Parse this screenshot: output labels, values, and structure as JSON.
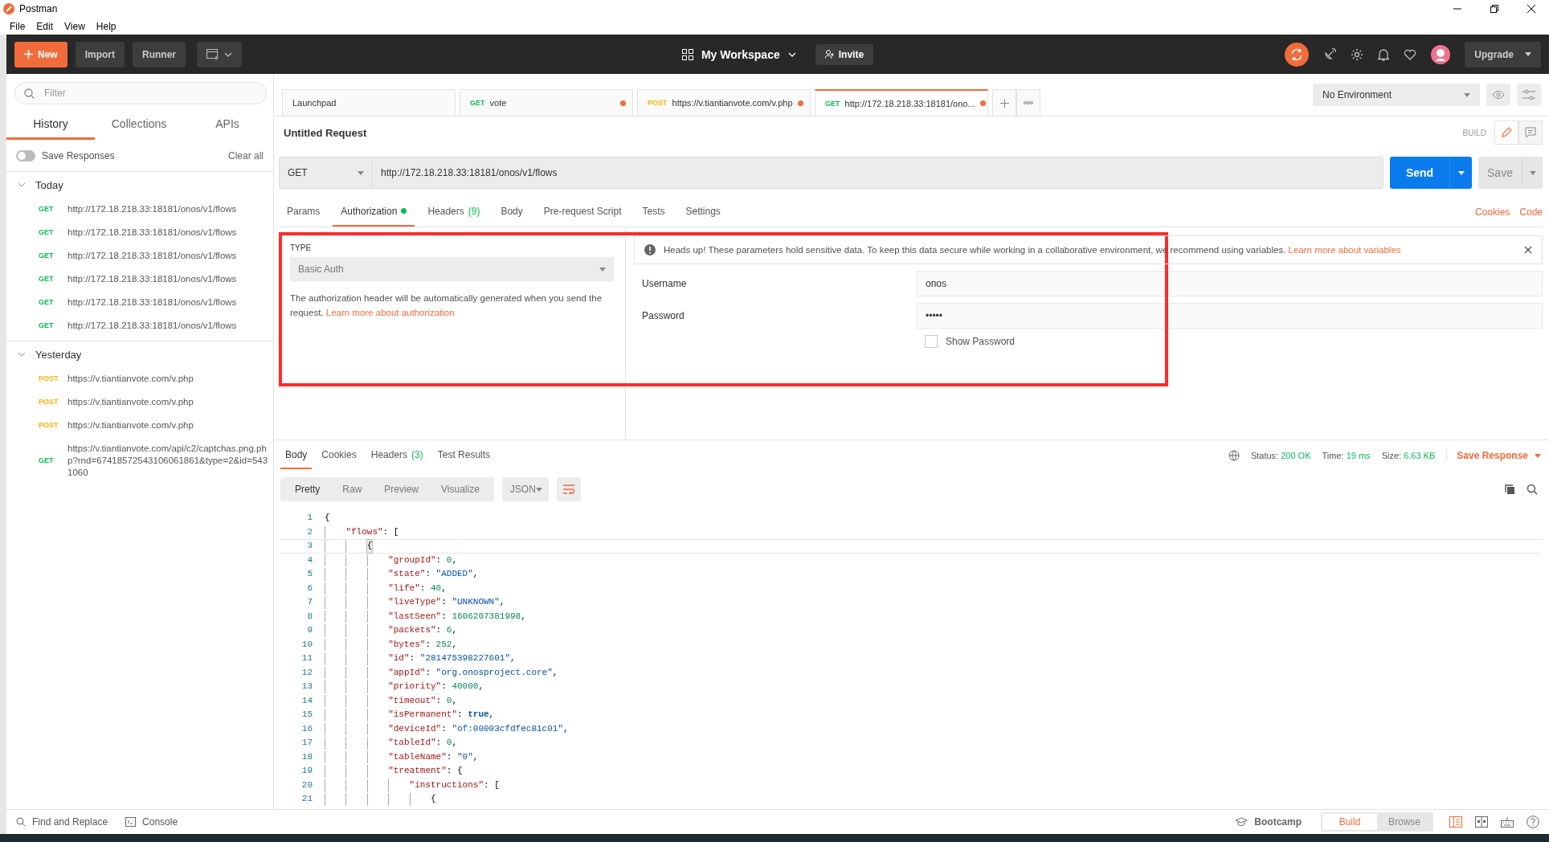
{
  "window": {
    "title": "Postman",
    "menu": [
      "File",
      "Edit",
      "View",
      "Help"
    ]
  },
  "header": {
    "new_button": "New",
    "buttons": [
      "Import",
      "Runner"
    ],
    "workspace": "My Workspace",
    "invite": "Invite",
    "upgrade": "Upgrade"
  },
  "sidebar": {
    "filter_placeholder": "Filter",
    "tabs": [
      {
        "label": "History",
        "selected": true
      },
      {
        "label": "Collections",
        "selected": false
      },
      {
        "label": "APIs",
        "selected": false
      }
    ],
    "save_responses": {
      "label": "Save Responses",
      "on": false
    },
    "clear_all": "Clear all",
    "groups": [
      {
        "label": "Today",
        "expanded": true,
        "items": [
          {
            "method": "GET",
            "color": "#0cbb52",
            "url": "http://172.18.218.33:18181/onos/v1/flows"
          },
          {
            "method": "GET",
            "color": "#0cbb52",
            "url": "http://172.18.218.33:18181/onos/v1/flows"
          },
          {
            "method": "GET",
            "color": "#0cbb52",
            "url": "http://172.18.218.33:18181/onos/v1/flows"
          },
          {
            "method": "GET",
            "color": "#0cbb52",
            "url": "http://172.18.218.33:18181/onos/v1/flows"
          },
          {
            "method": "GET",
            "color": "#0cbb52",
            "url": "http://172.18.218.33:18181/onos/v1/flows"
          },
          {
            "method": "GET",
            "color": "#0cbb52",
            "url": "http://172.18.218.33:18181/onos/v1/flows"
          }
        ]
      },
      {
        "label": "Yesterday",
        "expanded": true,
        "items": [
          {
            "method": "POST",
            "color": "#ffb400",
            "url": "https://v.tiantianvote.com/v.php"
          },
          {
            "method": "POST",
            "color": "#ffb400",
            "url": "https://v.tiantianvote.com/v.php"
          },
          {
            "method": "POST",
            "color": "#ffb400",
            "url": "https://v.tiantianvote.com/v.php"
          },
          {
            "method": "GET",
            "color": "#0cbb52",
            "url": "https://v.tiantianvote.com/api/c2/captchas.png.php?rnd=67418572543106061861&type=2&id=5431060"
          }
        ]
      }
    ]
  },
  "tabs": {
    "items": [
      {
        "label": "Launchpad",
        "selected": false,
        "unsaved": false
      },
      {
        "method": "GET",
        "color": "#0cbb52",
        "label": "vote",
        "selected": false,
        "unsaved": true
      },
      {
        "method": "POST",
        "color": "#ffb400",
        "label": "https://v.tiantianvote.com/v.php",
        "selected": false,
        "unsaved": true
      },
      {
        "method": "GET",
        "color": "#0cbb52",
        "label": "http://172.18.218.33:18181/ono...",
        "selected": true,
        "unsaved": true
      }
    ],
    "environment": "No Environment"
  },
  "request": {
    "title": "Untitled Request",
    "mode_label": "BUILD",
    "method": "GET",
    "url": "http://172.18.218.33:18181/onos/v1/flows",
    "send": "Send",
    "save": "Save",
    "tabs": [
      {
        "label": "Params",
        "selected": false,
        "indicator": false
      },
      {
        "label": "Authorization",
        "selected": true,
        "indicator": true
      },
      {
        "label": "Headers",
        "count": "(9)",
        "selected": false,
        "indicator": false
      },
      {
        "label": "Body",
        "selected": false,
        "indicator": false
      },
      {
        "label": "Pre-request Script",
        "selected": false,
        "indicator": false
      },
      {
        "label": "Tests",
        "selected": false,
        "indicator": false
      },
      {
        "label": "Settings",
        "selected": false,
        "indicator": false
      }
    ],
    "links": [
      "Cookies",
      "Code"
    ],
    "auth": {
      "type_label": "TYPE",
      "type": "Basic Auth",
      "description": "The authorization header will be automatically generated when you send the request.",
      "description_link": "Learn more about authorization",
      "notice": "Heads up! These parameters hold sensitive data. To keep this data secure while working in a collaborative environment, we recommend using variables.",
      "notice_link": "Learn more about variables",
      "fields": [
        {
          "label": "Username",
          "value": "onos"
        },
        {
          "label": "Password",
          "value": "•••••"
        }
      ],
      "show_password": {
        "label": "Show Password",
        "checked": false
      },
      "highlighted": true
    }
  },
  "response": {
    "tabs": [
      {
        "label": "Body",
        "selected": true
      },
      {
        "label": "Cookies",
        "selected": false
      },
      {
        "label": "Headers",
        "count": "(3)",
        "selected": false
      },
      {
        "label": "Test Results",
        "selected": false
      }
    ],
    "metrics": [
      {
        "label": "Status:",
        "value": "200 OK"
      },
      {
        "label": "Time:",
        "value": "19 ms"
      },
      {
        "label": "Size:",
        "value": "6.63 KB"
      }
    ],
    "save": "Save Response",
    "views": [
      {
        "label": "Pretty",
        "selected": true
      },
      {
        "label": "Raw",
        "selected": false
      },
      {
        "label": "Preview",
        "selected": false
      },
      {
        "label": "Visualize",
        "selected": false
      }
    ],
    "format": "JSON",
    "lines": [
      {
        "number": "1",
        "active": false,
        "tokens": [
          {
            "kind": "punct",
            "text": "{"
          }
        ]
      },
      {
        "number": "2",
        "active": false,
        "tokens": [
          {
            "kind": "key",
            "text": "\"flows\""
          },
          {
            "kind": "punct",
            "text": ": ["
          }
        ]
      },
      {
        "number": "3",
        "active": true,
        "tokens": [
          {
            "kind": "punct",
            "text": "{"
          }
        ]
      },
      {
        "number": "4",
        "active": false,
        "tokens": [
          {
            "kind": "key",
            "text": "\"groupId\""
          },
          {
            "kind": "punct",
            "text": ": "
          },
          {
            "kind": "number",
            "text": "0"
          },
          {
            "kind": "punct",
            "text": ","
          }
        ]
      },
      {
        "number": "5",
        "active": false,
        "tokens": [
          {
            "kind": "key",
            "text": "\"state\""
          },
          {
            "kind": "punct",
            "text": ": "
          },
          {
            "kind": "string",
            "text": "\"ADDED\""
          },
          {
            "kind": "punct",
            "text": ","
          }
        ]
      },
      {
        "number": "6",
        "active": false,
        "tokens": [
          {
            "kind": "key",
            "text": "\"life\""
          },
          {
            "kind": "punct",
            "text": ": "
          },
          {
            "kind": "number",
            "text": "40"
          },
          {
            "kind": "punct",
            "text": ","
          }
        ]
      },
      {
        "number": "7",
        "active": false,
        "tokens": [
          {
            "kind": "key",
            "text": "\"liveType\""
          },
          {
            "kind": "punct",
            "text": ": "
          },
          {
            "kind": "string",
            "text": "\"UNKNOWN\""
          },
          {
            "kind": "punct",
            "text": ","
          }
        ]
      },
      {
        "number": "8",
        "active": false,
        "tokens": [
          {
            "kind": "key",
            "text": "\"lastSeen\""
          },
          {
            "kind": "punct",
            "text": ": "
          },
          {
            "kind": "number",
            "text": "1606207381998"
          },
          {
            "kind": "punct",
            "text": ","
          }
        ]
      },
      {
        "number": "9",
        "active": false,
        "tokens": [
          {
            "kind": "key",
            "text": "\"packets\""
          },
          {
            "kind": "punct",
            "text": ": "
          },
          {
            "kind": "number",
            "text": "6"
          },
          {
            "kind": "punct",
            "text": ","
          }
        ]
      },
      {
        "number": "10",
        "active": false,
        "tokens": [
          {
            "kind": "key",
            "text": "\"bytes\""
          },
          {
            "kind": "punct",
            "text": ": "
          },
          {
            "kind": "number",
            "text": "252"
          },
          {
            "kind": "punct",
            "text": ","
          }
        ]
      },
      {
        "number": "11",
        "active": false,
        "tokens": [
          {
            "kind": "key",
            "text": "\"id\""
          },
          {
            "kind": "punct",
            "text": ": "
          },
          {
            "kind": "string",
            "text": "\"281475398227601\""
          },
          {
            "kind": "punct",
            "text": ","
          }
        ]
      },
      {
        "number": "12",
        "active": false,
        "tokens": [
          {
            "kind": "key",
            "text": "\"appId\""
          },
          {
            "kind": "punct",
            "text": ": "
          },
          {
            "kind": "string",
            "text": "\"org.onosproject.core\""
          },
          {
            "kind": "punct",
            "text": ","
          }
        ]
      },
      {
        "number": "13",
        "active": false,
        "tokens": [
          {
            "kind": "key",
            "text": "\"priority\""
          },
          {
            "kind": "punct",
            "text": ": "
          },
          {
            "kind": "number",
            "text": "40000"
          },
          {
            "kind": "punct",
            "text": ","
          }
        ]
      },
      {
        "number": "14",
        "active": false,
        "tokens": [
          {
            "kind": "key",
            "text": "\"timeout\""
          },
          {
            "kind": "punct",
            "text": ": "
          },
          {
            "kind": "number",
            "text": "0"
          },
          {
            "kind": "punct",
            "text": ","
          }
        ]
      },
      {
        "number": "15",
        "active": false,
        "tokens": [
          {
            "kind": "key",
            "text": "\"isPermanent\""
          },
          {
            "kind": "punct",
            "text": ": "
          },
          {
            "kind": "boolean",
            "text": "true"
          },
          {
            "kind": "punct",
            "text": ","
          }
        ]
      },
      {
        "number": "16",
        "active": false,
        "tokens": [
          {
            "kind": "key",
            "text": "\"deviceId\""
          },
          {
            "kind": "punct",
            "text": ": "
          },
          {
            "kind": "string",
            "text": "\"of:00003cfdfec81c01\""
          },
          {
            "kind": "punct",
            "text": ","
          }
        ]
      },
      {
        "number": "17",
        "active": false,
        "tokens": [
          {
            "kind": "key",
            "text": "\"tableId\""
          },
          {
            "kind": "punct",
            "text": ": "
          },
          {
            "kind": "number",
            "text": "0"
          },
          {
            "kind": "punct",
            "text": ","
          }
        ]
      },
      {
        "number": "18",
        "active": false,
        "tokens": [
          {
            "kind": "key",
            "text": "\"tableName\""
          },
          {
            "kind": "punct",
            "text": ": "
          },
          {
            "kind": "string",
            "text": "\"0\""
          },
          {
            "kind": "punct",
            "text": ","
          }
        ]
      },
      {
        "number": "19",
        "active": false,
        "tokens": [
          {
            "kind": "key",
            "text": "\"treatment\""
          },
          {
            "kind": "punct",
            "text": ": {"
          }
        ]
      },
      {
        "number": "20",
        "active": false,
        "tokens": [
          {
            "kind": "key",
            "text": "\"instructions\""
          },
          {
            "kind": "punct",
            "text": ": ["
          }
        ]
      },
      {
        "number": "21",
        "active": false,
        "tokens": [
          {
            "kind": "punct",
            "text": "{"
          }
        ]
      }
    ]
  },
  "status_bar": {
    "left": [
      "Find and Replace",
      "Console"
    ],
    "bootcamp": "Bootcamp",
    "modes": [
      {
        "label": "Build",
        "selected": true
      },
      {
        "label": "Browse",
        "selected": false
      }
    ]
  }
}
